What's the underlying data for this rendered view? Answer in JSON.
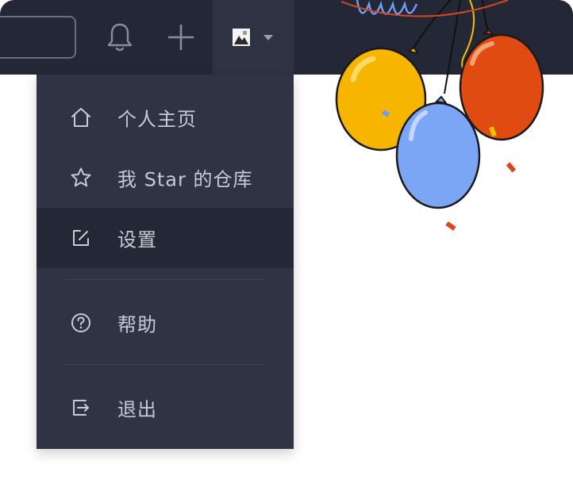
{
  "topbar": {
    "icons": [
      "bell-icon",
      "plus-icon"
    ],
    "avatar_icon": "avatar-image",
    "caret_icon": "caret-down-icon"
  },
  "user_menu": {
    "items": [
      {
        "label": "个人主页",
        "icon": "home-icon"
      },
      {
        "label": "我 Star 的仓库",
        "icon": "star-icon"
      },
      {
        "label": "设置",
        "icon": "edit-icon",
        "active": true
      },
      {
        "label": "帮助",
        "icon": "help-circle-icon"
      },
      {
        "label": "退出",
        "icon": "logout-icon"
      }
    ]
  },
  "colors": {
    "topbar_bg": "#242735",
    "menu_bg": "#2f3344",
    "menu_active_bg": "#242735",
    "menu_text": "#c8cad4",
    "balloon_yellow": "#f7b500",
    "balloon_blue": "#7aa6f5",
    "balloon_orange": "#e04b12"
  }
}
